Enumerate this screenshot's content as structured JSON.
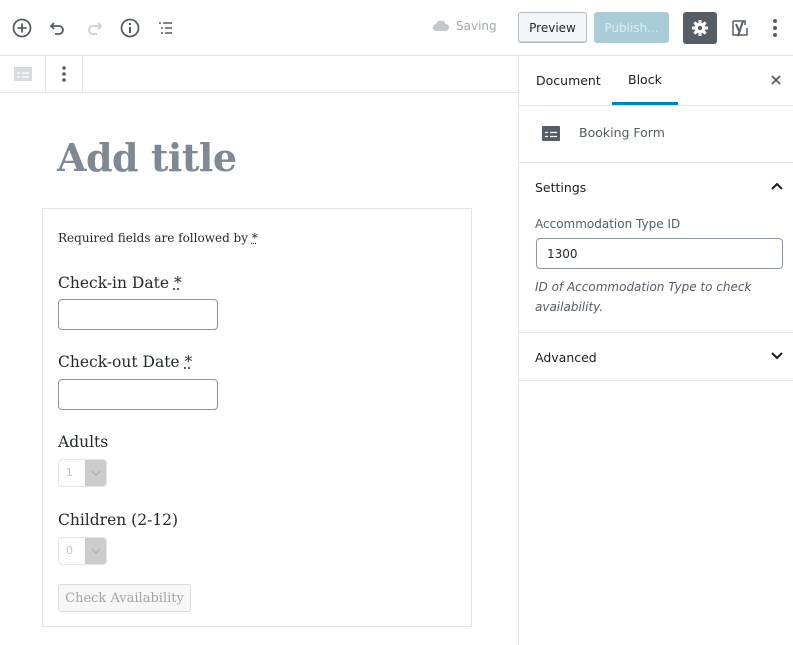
{
  "topbar": {
    "icons": {
      "add": "plus-circle-icon",
      "undo": "undo-icon",
      "redo": "redo-icon",
      "info": "info-icon",
      "outline": "list-outline-icon"
    },
    "saving_label": "Saving",
    "preview_label": "Preview",
    "publish_label": "Publish...",
    "colors": {
      "settings_bg": "#555d66",
      "publish_bg": "#a9ccd8",
      "accent": "#0085ba"
    }
  },
  "editor": {
    "title_placeholder": "Add title",
    "form": {
      "required_note": "Required fields are followed by",
      "required_mark": "*",
      "checkin_label": "Check-in Date",
      "checkout_label": "Check-out Date",
      "adults_label": "Adults",
      "adults_value": "1",
      "children_label": "Children (2-12)",
      "children_value": "0",
      "submit_label": "Check Availability"
    }
  },
  "sidebar": {
    "tabs": [
      {
        "label": "Document",
        "active": false
      },
      {
        "label": "Block",
        "active": true
      }
    ],
    "block_name": "Booking Form",
    "settings_title": "Settings",
    "field_label": "Accommodation Type ID",
    "field_value": "1300",
    "field_help": "ID of Accommodation Type to check availability.",
    "advanced_title": "Advanced"
  }
}
